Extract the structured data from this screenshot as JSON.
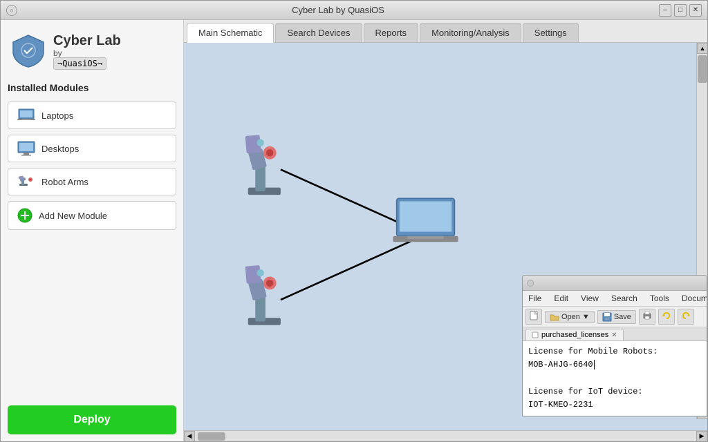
{
  "window": {
    "title": "Cyber Lab by QuasiOS",
    "minimize_label": "–",
    "maximize_label": "□",
    "close_label": "✕"
  },
  "sidebar": {
    "logo_line1": "Cyber Lab",
    "logo_line2": "by",
    "logo_brand": "¬QuasiOS¬",
    "installed_modules_label": "Installed Modules",
    "modules": [
      {
        "id": "laptops",
        "label": "Laptops"
      },
      {
        "id": "desktops",
        "label": "Desktops"
      },
      {
        "id": "robot-arms",
        "label": "Robot Arms"
      }
    ],
    "add_module_label": "Add New Module",
    "deploy_label": "Deploy"
  },
  "tabs": [
    {
      "id": "main-schematic",
      "label": "Main Schematic",
      "active": true
    },
    {
      "id": "search-devices",
      "label": "Search Devices",
      "active": false
    },
    {
      "id": "reports",
      "label": "Reports",
      "active": false
    },
    {
      "id": "monitoring",
      "label": "Monitoring/Analysis",
      "active": false
    },
    {
      "id": "settings",
      "label": "Settings",
      "active": false
    }
  ],
  "schematic": {
    "background_color": "#c8d8e8"
  },
  "text_editor": {
    "title_dot": "",
    "menu_items": [
      "File",
      "Edit",
      "View",
      "Search",
      "Tools",
      "Docum..."
    ],
    "toolbar_items": [
      "Open",
      "▼",
      "Save"
    ],
    "tab_label": "purchased_licenses",
    "content_lines": [
      "License for Mobile Robots:",
      "MOB-AHJG-6640",
      "",
      "License for IoT device:",
      "IOT-KMEO-2231"
    ],
    "cursor_after_line": 1
  }
}
